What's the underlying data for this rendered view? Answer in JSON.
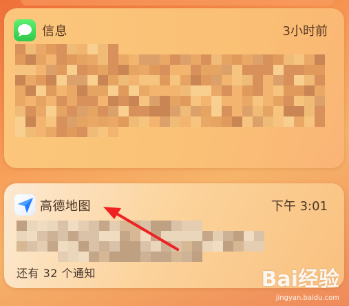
{
  "notifications": [
    {
      "app_name": "信息",
      "time": "3小时前",
      "icon": "message-bubble-icon"
    },
    {
      "app_name": "高德地图",
      "time": "下午 3:01",
      "icon": "amap-navigation-icon",
      "more_label": "还有 32 个通知"
    }
  ],
  "watermark": {
    "logo": "Bai经验",
    "url": "jingyan.baidu.com"
  },
  "colors": {
    "arrow": "#ee2222",
    "message_green": "#34c759",
    "amap_blue": "#1f7bff"
  }
}
